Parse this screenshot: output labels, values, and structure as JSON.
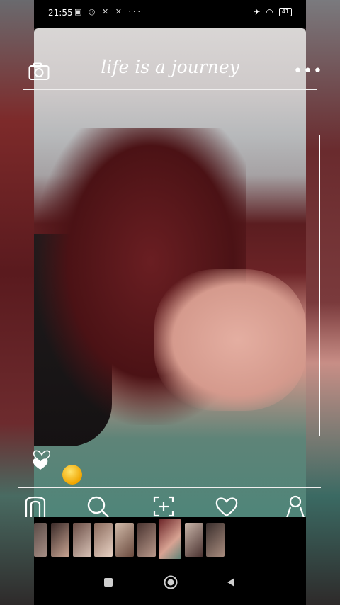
{
  "status_bar": {
    "time": "21:55",
    "icons_left": [
      "notification-icon",
      "whatsapp-icon",
      "app-icon",
      "app-icon"
    ],
    "more": "···",
    "battery": "41",
    "icons_right": [
      "airplane-icon",
      "wifi-icon",
      "battery-icon"
    ]
  },
  "header": {
    "title": "life is a journey",
    "camera_icon": "camera-icon",
    "more_icon": "more-icon"
  },
  "reactions": {
    "heart": "heart-icon",
    "emoji": "sun-emoji"
  },
  "bottom_nav": {
    "items": [
      "home-icon",
      "search-icon",
      "add-post-icon",
      "heart-icon",
      "profile-icon"
    ]
  },
  "gallery_strip": {
    "count": 10,
    "selected_index": 7
  },
  "system_nav": [
    "recents-button",
    "home-button",
    "back-button"
  ],
  "colors": {
    "accent": "#ffffff",
    "status_bg": "#000000"
  }
}
